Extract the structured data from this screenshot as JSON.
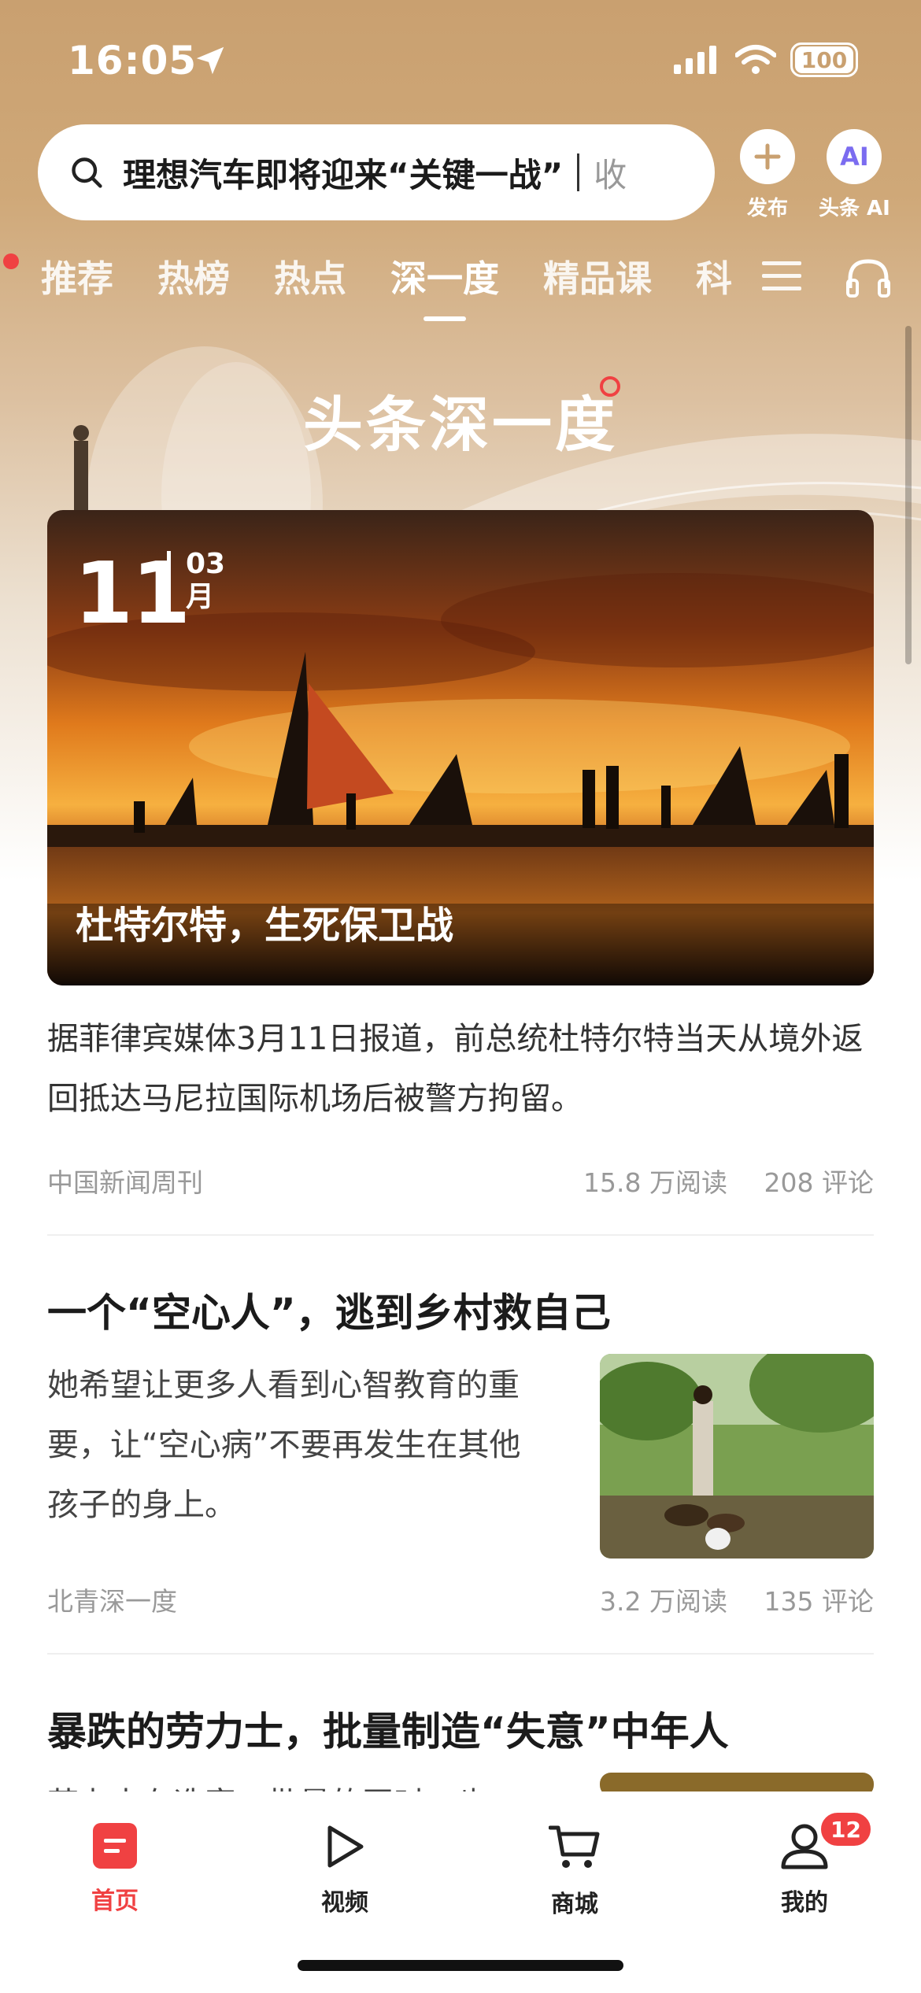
{
  "status_bar": {
    "time": "16:05",
    "battery": "100"
  },
  "search": {
    "query": "理想汽车即将迎来“关键一战”",
    "tail": "收"
  },
  "header_buttons": {
    "publish": "发布",
    "ai": "头条 AI",
    "ai_mark": "AI"
  },
  "tabs": [
    {
      "label": "推荐",
      "active": false
    },
    {
      "label": "热榜",
      "active": false
    },
    {
      "label": "热点",
      "active": false
    },
    {
      "label": "深一度",
      "active": true
    },
    {
      "label": "精品课",
      "active": false
    },
    {
      "label": "科",
      "active": false
    }
  ],
  "hero": {
    "title": "头条深一度"
  },
  "feature": {
    "day": "11",
    "month_num": "03",
    "month_char": "月",
    "title": "杜特尔特，生死保卫战",
    "description": "据菲律宾媒体3月11日报道，前总统杜特尔特当天从境外返回抵达马尼拉国际机场后被警方拘留。",
    "source": "中国新闻周刊",
    "reads": "15.8 万阅读",
    "comments": "208 评论"
  },
  "articles": [
    {
      "title": "一个“空心人”，逃到乡村救自己",
      "description": "她希望让更多人看到心智教育的重要，让“空心病”不要再发生在其他孩子的身上。",
      "source": "北青深一度",
      "reads": "3.2 万阅读",
      "comments": "135 评论"
    },
    {
      "title": "暴跌的劳力士，批量制造“失意”中年人",
      "description": "劳力士在造富，批量的同时，也"
    }
  ],
  "bottom_nav": [
    {
      "label": "首页",
      "icon": "home-icon",
      "active": true
    },
    {
      "label": "视频",
      "icon": "video-play-icon",
      "active": false
    },
    {
      "label": "商城",
      "icon": "cart-icon",
      "active": false
    },
    {
      "label": "我的",
      "icon": "profile-icon",
      "active": false,
      "badge": "12"
    }
  ],
  "colors": {
    "accent_red": "#f04142",
    "header_gold": "#c9a070"
  }
}
